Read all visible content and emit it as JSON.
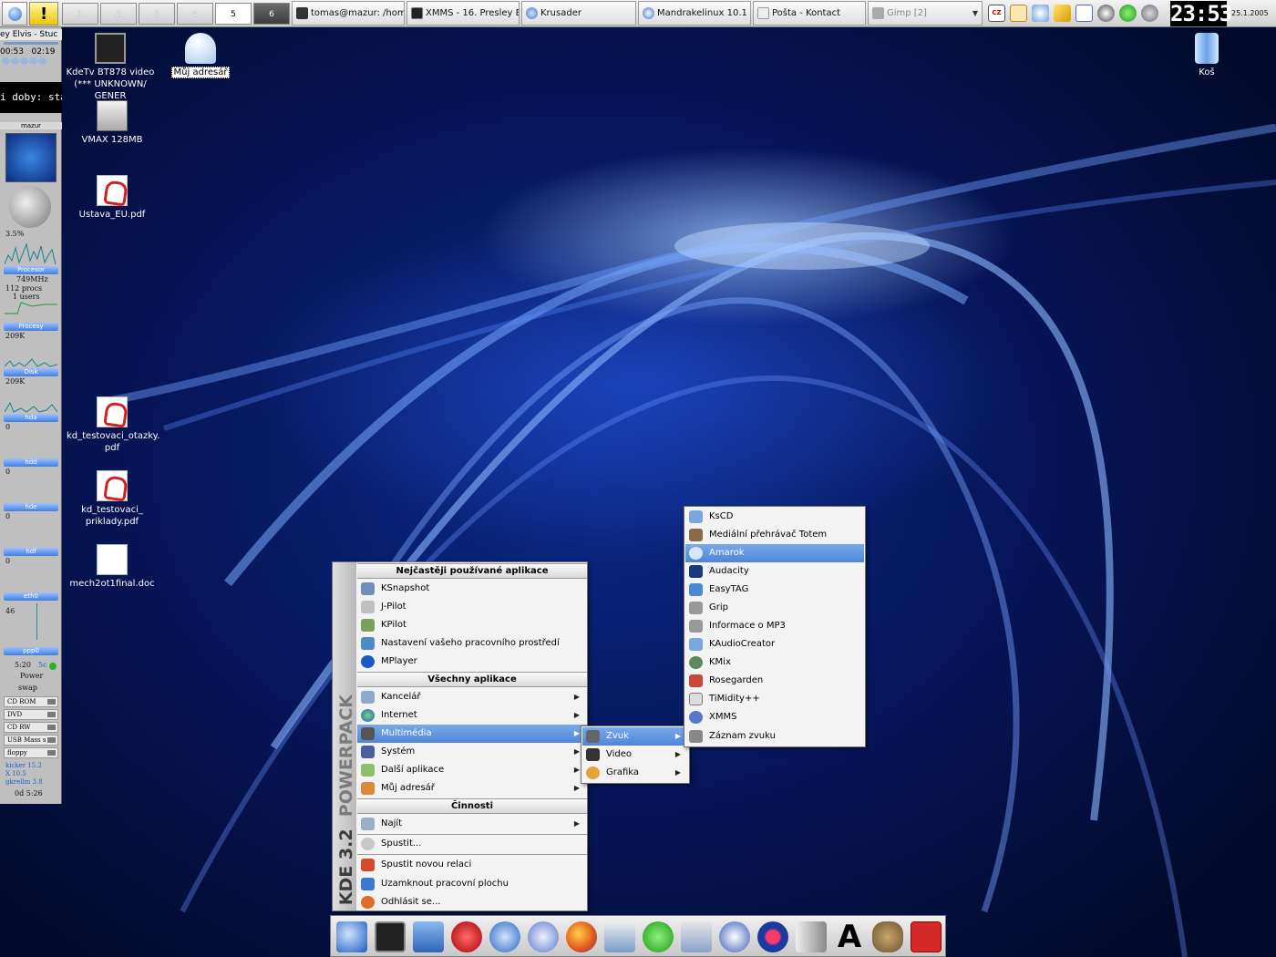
{
  "taskbar": {
    "pager": [
      "1",
      "2",
      "3",
      "4",
      "5",
      "6"
    ],
    "tasks": [
      {
        "label": "tomas@mazur: /home",
        "dim": false
      },
      {
        "label": "XMMS - 16. Presley E",
        "dim": false
      },
      {
        "label": "Krusader",
        "dim": false
      },
      {
        "label": "Mandrakelinux 10.1 - C",
        "dim": false
      },
      {
        "label": "Pošta - Kontact",
        "dim": false
      },
      {
        "label": "Gimp [2]",
        "dim": true
      }
    ],
    "clock": "23:53",
    "date": "25.1.2005",
    "lang": "CZ"
  },
  "gkrellm": {
    "song": "ey Elvis - Stuc",
    "time_elapsed": "00:53",
    "time_total": "02:19",
    "ticker": "i doby: stá",
    "host": "mazur",
    "cpu_pct": "3.5%",
    "proc_label": "Procesor",
    "mhz": "749MHz",
    "procs": "112 procs",
    "users": "1 users",
    "procesy": "Procesy",
    "procesy_val": "209K",
    "disk": "Disk",
    "disk_val": "209K",
    "hda": "hda",
    "hda_val": "0",
    "hdd": "hdd",
    "hdd_val": "0",
    "hde": "hde",
    "hde_val": "0",
    "hdf": "hdf",
    "hdf_val": "0",
    "eth0": "eth0",
    "eth0_val": "46",
    "ppp0": "ppp0",
    "ppp0_val": "5:20",
    "ppp0_val2": "5c",
    "power": "Power",
    "swap": "swap",
    "drives": [
      "CD ROM",
      "DVD",
      "CD RW",
      "USB Mass s",
      "floppy"
    ],
    "versions": [
      "kicker 15.2",
      "X 10.5",
      "gkrellm 3.8"
    ],
    "uptime": "0d 5:26"
  },
  "desktop": {
    "icons": [
      {
        "label": "KdeTv BT878 video (*** UNKNOWN/ GENER"
      },
      {
        "label": "Můj adresář"
      },
      {
        "label": "VMAX 128MB"
      },
      {
        "label": "Ustava_EU.pdf"
      },
      {
        "label": "kd_testovaci_otazky. pdf"
      },
      {
        "label": "kd_testovaci_ priklady.pdf"
      },
      {
        "label": "mech2ot1final.doc"
      },
      {
        "label": "Koš"
      }
    ]
  },
  "kmenu": {
    "sidebar_brand": "POWERPACK",
    "sidebar_version": "KDE 3.2",
    "section_frequent": "Nejčastěji používané aplikace",
    "frequent": [
      "KSnapshot",
      "J-Pilot",
      "KPilot",
      "Nastavení vašeho pracovního prostředí",
      "MPlayer"
    ],
    "section_all": "Všechny aplikace",
    "all": [
      "Kancelář",
      "Internet",
      "Multimédia",
      "Systém",
      "Další aplikace",
      "Můj adresář"
    ],
    "section_actions": "Činnosti",
    "actions": [
      "Najít",
      "Spustit...",
      "Spustit novou relaci",
      "Uzamknout pracovní plochu",
      "Odhlásit se..."
    ]
  },
  "submenu_multimedia": [
    "Zvuk",
    "Video",
    "Grafika"
  ],
  "submenu_zvuk": [
    "KsCD",
    "Mediální přehrávač Totem",
    "Amarok",
    "Audacity",
    "EasyTAG",
    "Grip",
    "Informace o MP3",
    "KAudioCreator",
    "KMix",
    "Rosegarden",
    "TiMidity++",
    "XMMS",
    "Záznam zvuku"
  ],
  "bottom_panel": {
    "icons": [
      "kmenu-icon",
      "konsole-icon",
      "network-icon",
      "kontact-icon",
      "globe-icon",
      "satellite-icon",
      "firefox-icon",
      "image-viewer-icon",
      "icq-icon",
      "disk-tool-icon",
      "xmms-icon",
      "record-icon",
      "volume-icon",
      "font-icon",
      "gimp-icon",
      "studio-icon"
    ]
  },
  "colors": {
    "highlight": "#4f86d8",
    "desktop": "#061557"
  }
}
